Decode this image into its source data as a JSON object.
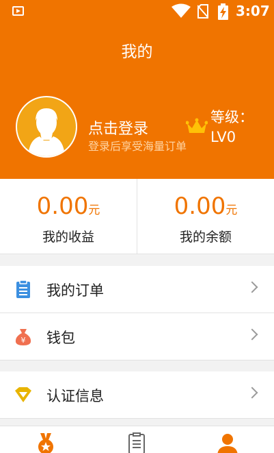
{
  "status_bar": {
    "time": "3:07",
    "icons": [
      "app-notification-icon",
      "wifi-icon",
      "no-sim-icon",
      "battery-charging-icon"
    ]
  },
  "header": {
    "title": "我的",
    "background_color": "#f07400"
  },
  "profile": {
    "avatar_icon": "default-user-avatar",
    "login_label": "点击登录",
    "login_subtitle": "登录后享受海量订单",
    "level_icon": "crown-icon",
    "level_label": "等级：LV0"
  },
  "stats": [
    {
      "value": "0.00",
      "unit": "元",
      "label": "我的收益"
    },
    {
      "value": "0.00",
      "unit": "元",
      "label": "我的余额"
    }
  ],
  "menu": [
    {
      "label": "我的订单",
      "icon": "clipboard-icon"
    },
    {
      "label": "钱包",
      "icon": "money-bag-icon"
    },
    {
      "label": "认证信息",
      "icon": "diamond-icon"
    }
  ],
  "tabbar": {
    "tabs": [
      {
        "icon": "medal-icon",
        "active": true
      },
      {
        "icon": "clipboard-list-icon",
        "active": false
      },
      {
        "icon": "user-icon",
        "active": true
      }
    ]
  },
  "colors": {
    "accent": "#f07400",
    "stat_value": "#f07400",
    "avatar_bg": "#f2a516",
    "crown": "#ffc107",
    "order_icon": "#3b8fe0",
    "wallet_icon": "#f07050",
    "verify_icon": "#e8b400"
  }
}
